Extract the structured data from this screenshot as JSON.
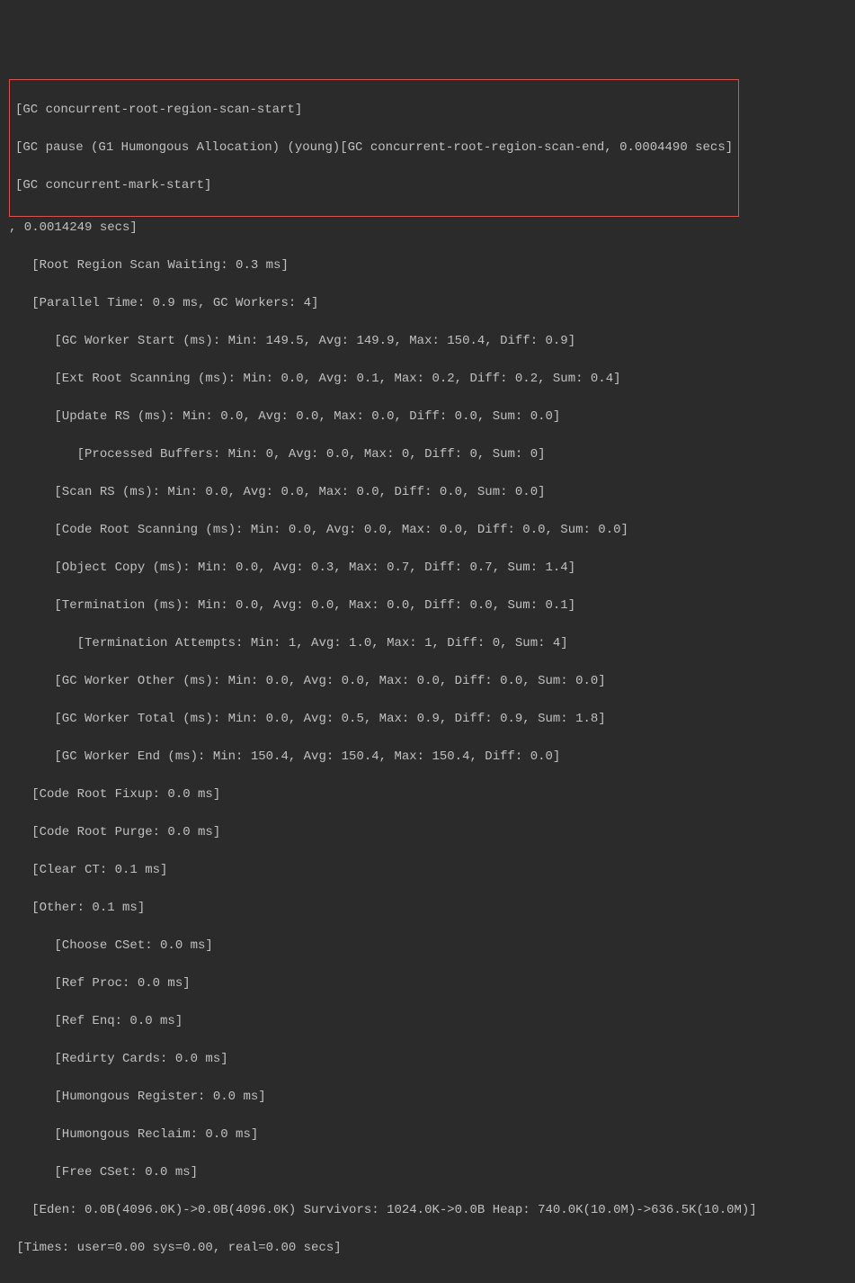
{
  "highlight": {
    "l1": "[GC concurrent-root-region-scan-start]",
    "l2": "[GC pause (G1 Humongous Allocation) (young)[GC concurrent-root-region-scan-end, 0.0004490 secs]",
    "l3": "[GC concurrent-mark-start]"
  },
  "log": {
    "l0": ", 0.0014249 secs]",
    "l1": "   [Root Region Scan Waiting: 0.3 ms]",
    "l2": "   [Parallel Time: 0.9 ms, GC Workers: 4]",
    "l3": "      [GC Worker Start (ms): Min: 149.5, Avg: 149.9, Max: 150.4, Diff: 0.9]",
    "l4": "      [Ext Root Scanning (ms): Min: 0.0, Avg: 0.1, Max: 0.2, Diff: 0.2, Sum: 0.4]",
    "l5": "      [Update RS (ms): Min: 0.0, Avg: 0.0, Max: 0.0, Diff: 0.0, Sum: 0.0]",
    "l6": "         [Processed Buffers: Min: 0, Avg: 0.0, Max: 0, Diff: 0, Sum: 0]",
    "l7": "      [Scan RS (ms): Min: 0.0, Avg: 0.0, Max: 0.0, Diff: 0.0, Sum: 0.0]",
    "l8": "      [Code Root Scanning (ms): Min: 0.0, Avg: 0.0, Max: 0.0, Diff: 0.0, Sum: 0.0]",
    "l9": "      [Object Copy (ms): Min: 0.0, Avg: 0.3, Max: 0.7, Diff: 0.7, Sum: 1.4]",
    "l10": "      [Termination (ms): Min: 0.0, Avg: 0.0, Max: 0.0, Diff: 0.0, Sum: 0.1]",
    "l11": "         [Termination Attempts: Min: 1, Avg: 1.0, Max: 1, Diff: 0, Sum: 4]",
    "l12": "      [GC Worker Other (ms): Min: 0.0, Avg: 0.0, Max: 0.0, Diff: 0.0, Sum: 0.0]",
    "l13": "      [GC Worker Total (ms): Min: 0.0, Avg: 0.5, Max: 0.9, Diff: 0.9, Sum: 1.8]",
    "l14": "      [GC Worker End (ms): Min: 150.4, Avg: 150.4, Max: 150.4, Diff: 0.0]",
    "l15": "   [Code Root Fixup: 0.0 ms]",
    "l16": "   [Code Root Purge: 0.0 ms]",
    "l17": "   [Clear CT: 0.1 ms]",
    "l18": "   [Other: 0.1 ms]",
    "l19": "      [Choose CSet: 0.0 ms]",
    "l20": "      [Ref Proc: 0.0 ms]",
    "l21": "      [Ref Enq: 0.0 ms]",
    "l22": "      [Redirty Cards: 0.0 ms]",
    "l23": "      [Humongous Register: 0.0 ms]",
    "l24": "      [Humongous Reclaim: 0.0 ms]",
    "l25": "      [Free CSet: 0.0 ms]",
    "l26": "   [Eden: 0.0B(4096.0K)->0.0B(4096.0K) Survivors: 1024.0K->0.0B Heap: 740.0K(10.0M)->636.5K(10.0M)]",
    "l27": " [Times: user=0.00 sys=0.00, real=0.00 secs]"
  }
}
